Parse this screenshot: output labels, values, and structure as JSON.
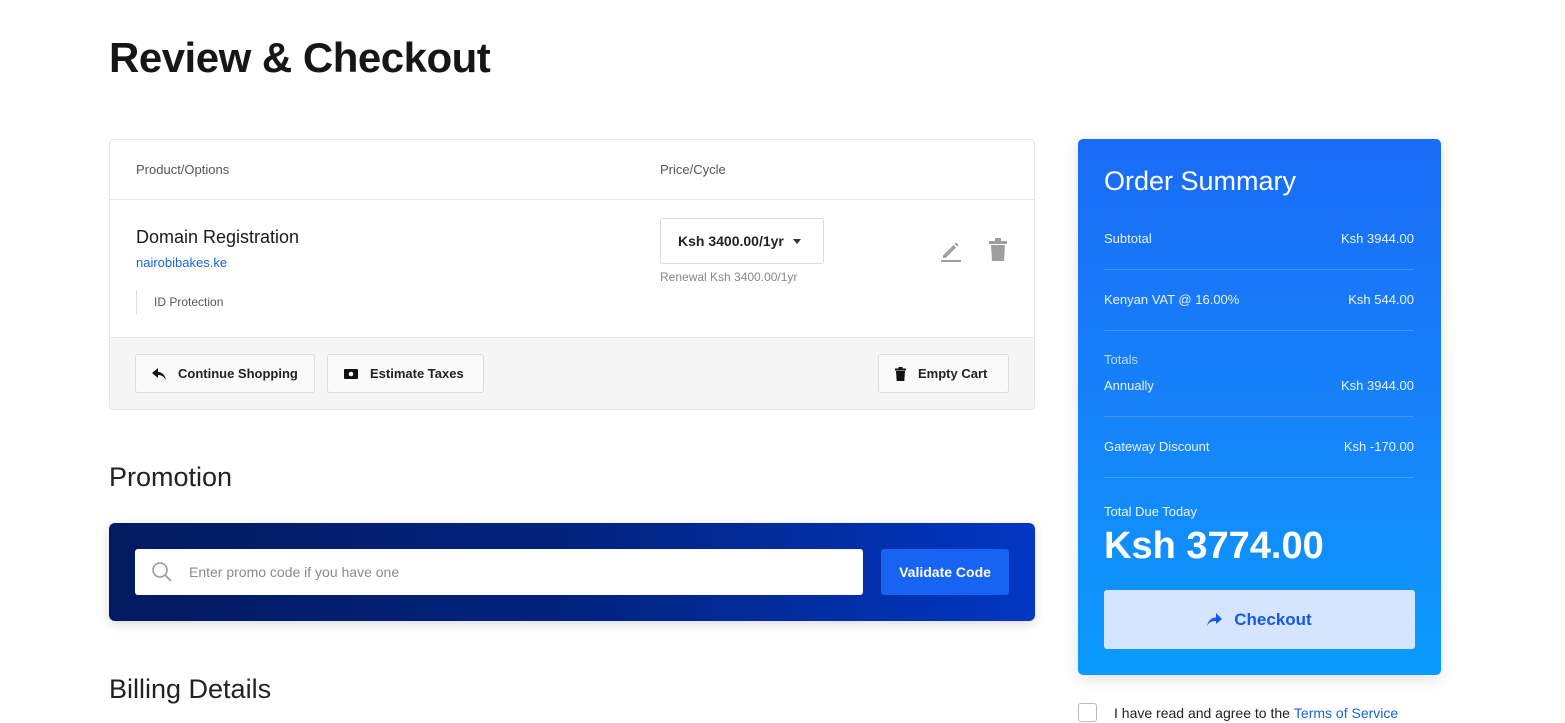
{
  "page": {
    "title": "Review & Checkout"
  },
  "cart": {
    "headers": {
      "product": "Product/Options",
      "price": "Price/Cycle"
    },
    "item": {
      "name": "Domain Registration",
      "domain": "nairobibakes.ke",
      "option": "ID Protection",
      "price": "Ksh 3400.00/1yr",
      "renewal": "Renewal Ksh 3400.00/1yr"
    },
    "actions": {
      "continue": "Continue Shopping",
      "estimate": "Estimate Taxes",
      "empty": "Empty Cart"
    }
  },
  "promotion": {
    "title": "Promotion",
    "placeholder": "Enter promo code if you have one",
    "validate": "Validate Code"
  },
  "billing": {
    "title": "Billing Details"
  },
  "summary": {
    "title": "Order Summary",
    "subtotal_label": "Subtotal",
    "subtotal_value": "Ksh 3944.00",
    "vat_label": "Kenyan VAT @ 16.00%",
    "vat_value": "Ksh 544.00",
    "totals_label": "Totals",
    "annually_label": "Annually",
    "annually_value": "Ksh 3944.00",
    "discount_label": "Gateway Discount",
    "discount_value": "Ksh -170.00",
    "due_label": "Total Due Today",
    "due_amount": "Ksh 3774.00",
    "checkout": "Checkout"
  },
  "tos": {
    "text": "I have read and agree to the",
    "link": "Terms of Service"
  },
  "colors": {
    "accent": "#1763f2",
    "summary_bg": "#1a6bf7",
    "promo_bg": "#02237e"
  },
  "icons": [
    "reply-icon",
    "money-icon",
    "trash-icon",
    "edit-icon",
    "search-icon",
    "arrow-icon"
  ]
}
